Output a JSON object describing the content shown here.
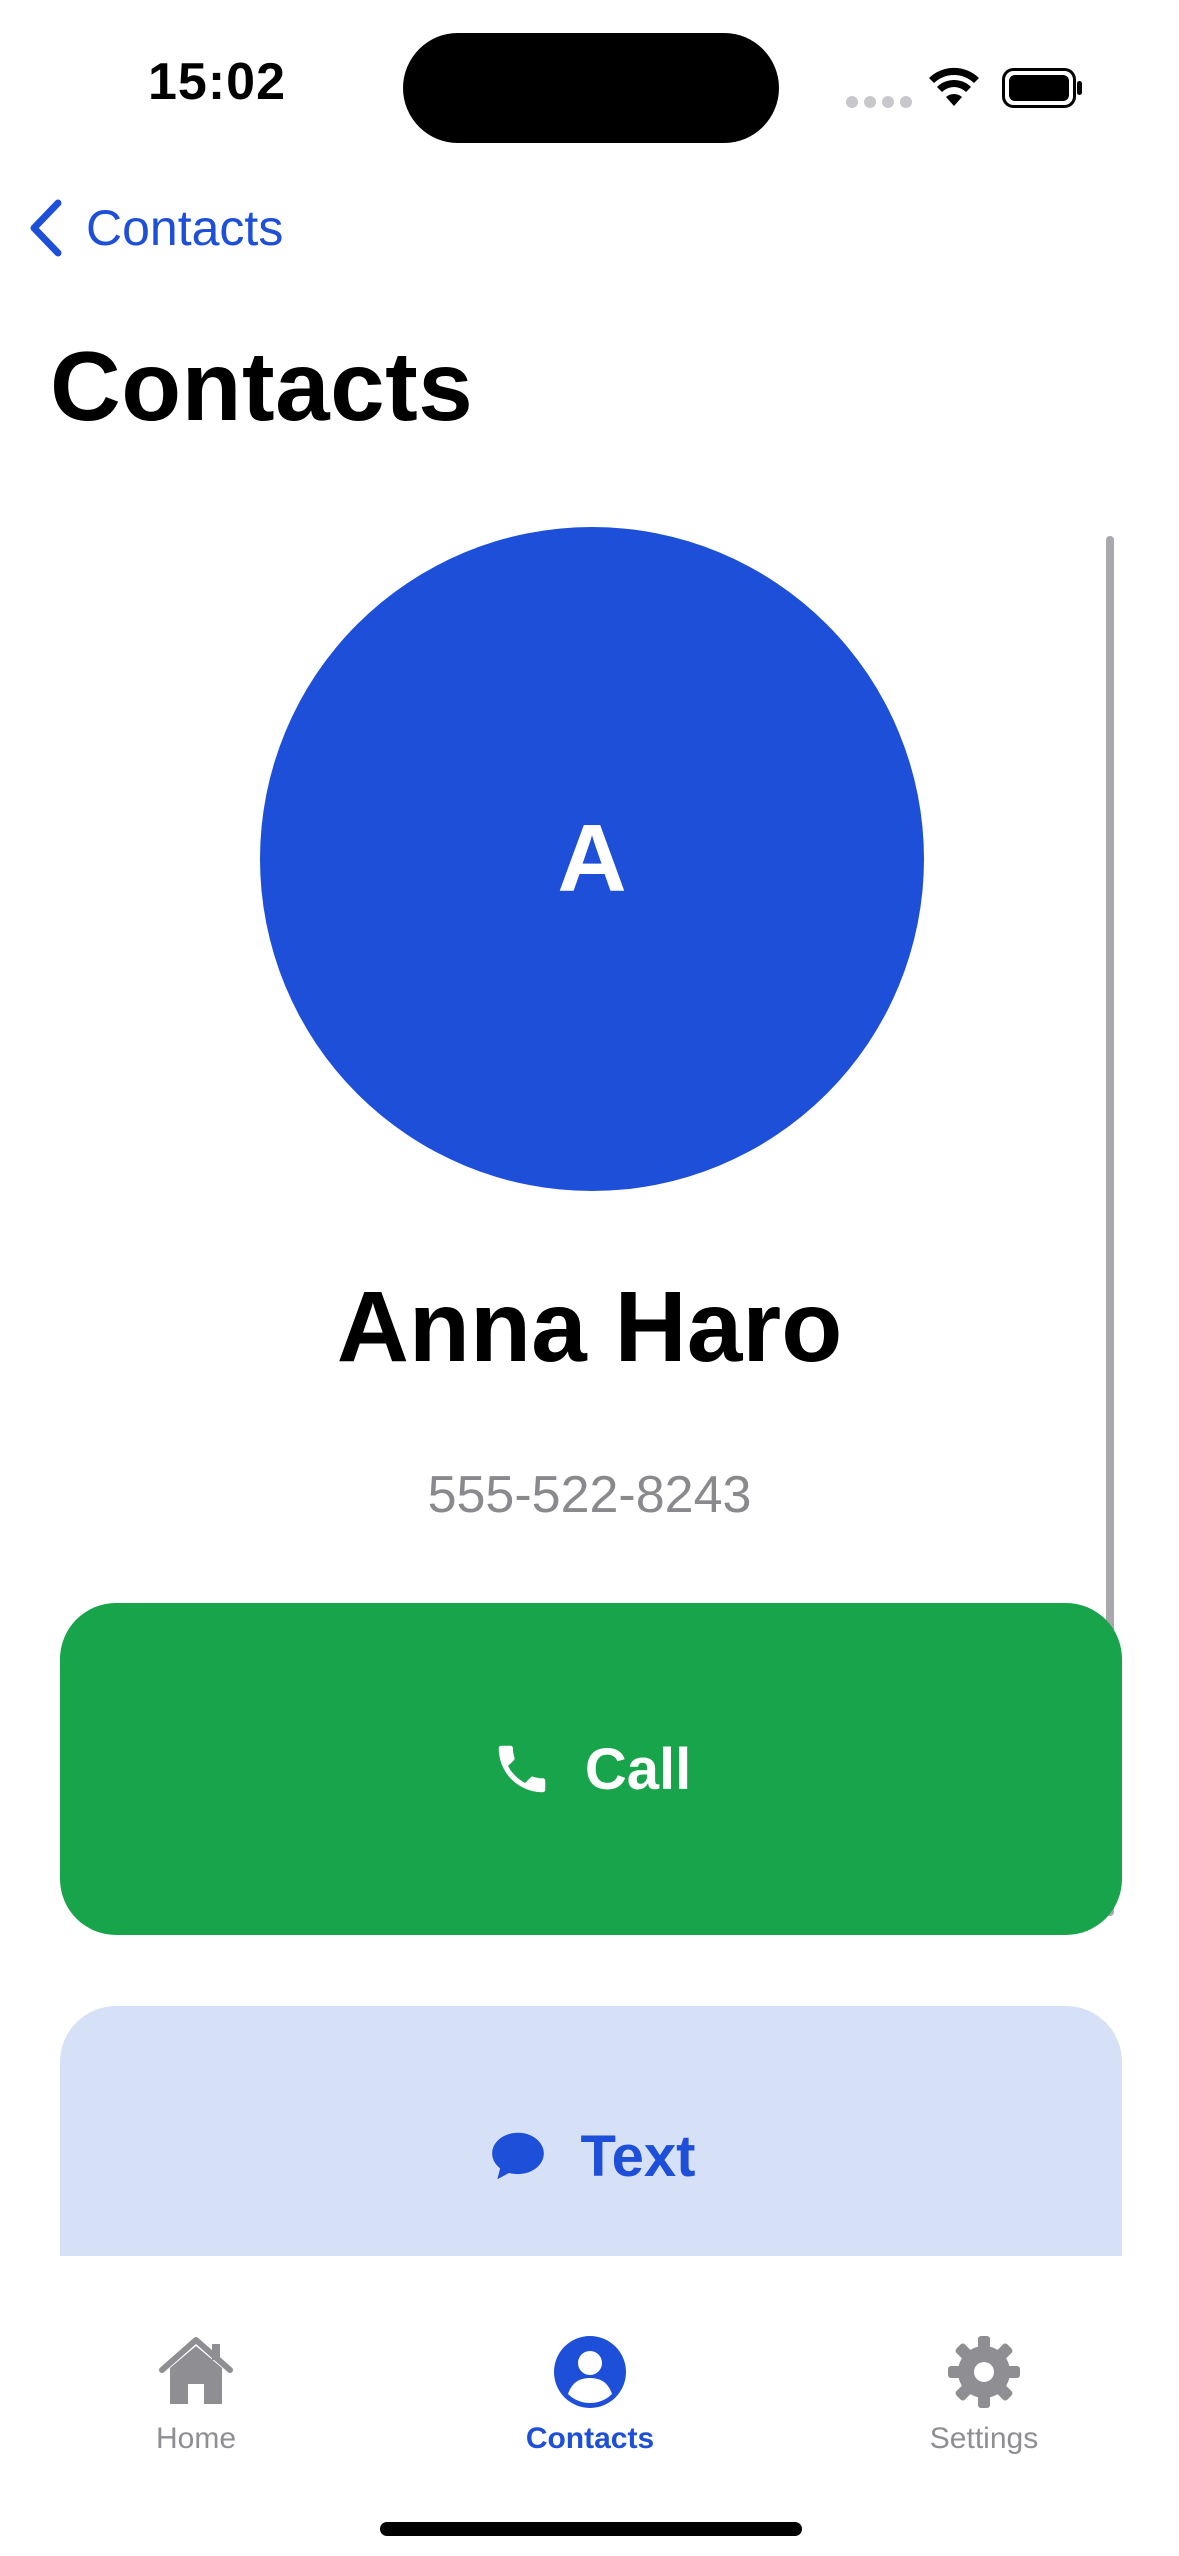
{
  "status_bar": {
    "time": "15:02"
  },
  "nav": {
    "back_label": "Contacts",
    "title": "Contacts"
  },
  "contact": {
    "initial": "A",
    "name": "Anna Haro",
    "phone": "555-522-8243",
    "avatar_color": "#1e4fd8"
  },
  "actions": {
    "call_label": "Call",
    "text_label": "Text",
    "call_color": "#18a44a",
    "text_bg_color": "#d6e0f6"
  },
  "tab_bar": {
    "items": [
      {
        "label": "Home",
        "icon": "house-icon",
        "selected": false
      },
      {
        "label": "Contacts",
        "icon": "person-circle-icon",
        "selected": true
      },
      {
        "label": "Settings",
        "icon": "gear-icon",
        "selected": false
      }
    ],
    "accent_color": "#1e4fd8",
    "inactive_color": "#8e8e93"
  }
}
